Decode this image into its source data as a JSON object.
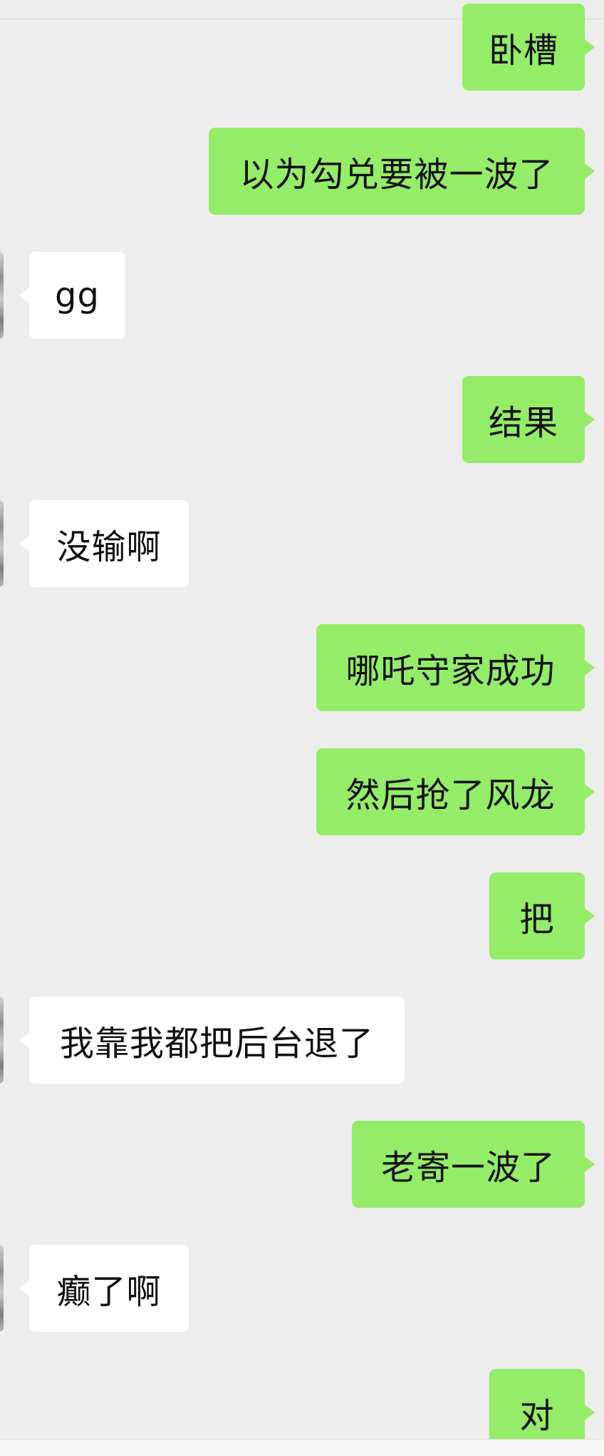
{
  "messages": [
    {
      "sender": "me",
      "text": "卧槽"
    },
    {
      "sender": "me",
      "text": "以为勾兑要被一波了"
    },
    {
      "sender": "other",
      "text": "gg"
    },
    {
      "sender": "me",
      "text": "结果"
    },
    {
      "sender": "other",
      "text": "没输啊"
    },
    {
      "sender": "me",
      "text": "哪吒守家成功"
    },
    {
      "sender": "me",
      "text": "然后抢了风龙"
    },
    {
      "sender": "me",
      "text": "把"
    },
    {
      "sender": "other",
      "text": "我靠我都把后台退了"
    },
    {
      "sender": "me",
      "text": "老寄一波了"
    },
    {
      "sender": "other",
      "text": "癫了啊"
    },
    {
      "sender": "me",
      "text": "对"
    }
  ],
  "colors": {
    "background": "#ededed",
    "my_bubble": "#95ec69",
    "other_bubble": "#ffffff",
    "text": "#111111"
  }
}
